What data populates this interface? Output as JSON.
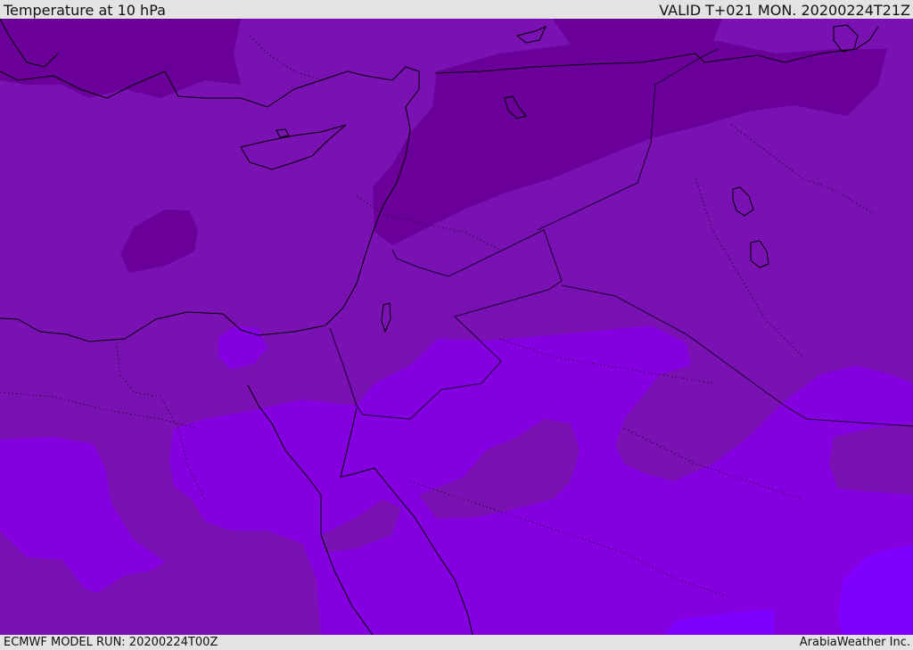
{
  "header": {
    "title": "Temperature at 10 hPa",
    "valid_time": "VALID T+021 MON. 20200224T21Z"
  },
  "footer": {
    "model_run": "ECMWF MODEL RUN: 20200224T00Z",
    "credit": "ArabiaWeather Inc."
  },
  "colors": {
    "coldest_band": "#6a0099",
    "cold_band": "#7a11b2",
    "mid_band": "#8500e0",
    "warm_band": "#7f00ff",
    "coastline": "#000000",
    "border": "#1a0030"
  }
}
